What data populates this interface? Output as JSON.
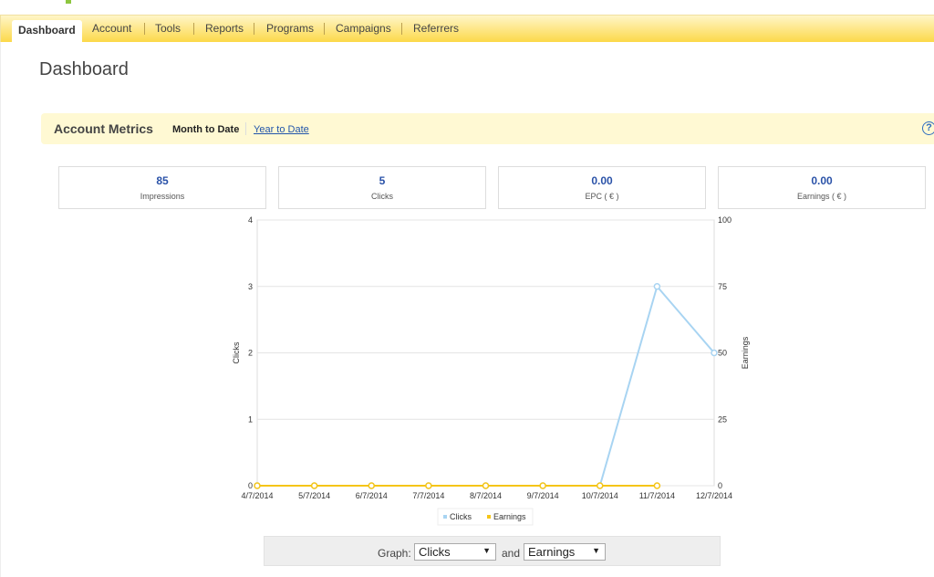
{
  "nav": {
    "tabs": [
      "Dashboard",
      "Account",
      "Tools",
      "Reports",
      "Programs",
      "Campaigns",
      "Referrers"
    ]
  },
  "page_title": "Dashboard",
  "metrics": {
    "title": "Account Metrics",
    "month": "Month to Date",
    "year": "Year to Date",
    "help": "?",
    "cards": [
      {
        "value": "85",
        "label": "Impressions"
      },
      {
        "value": "5",
        "label": "Clicks"
      },
      {
        "value": "0.00",
        "label": "EPC ( € )"
      },
      {
        "value": "0.00",
        "label": "Earnings ( € )"
      }
    ]
  },
  "chart_data": {
    "type": "line",
    "categories": [
      "4/7/2014",
      "5/7/2014",
      "6/7/2014",
      "7/7/2014",
      "8/7/2014",
      "9/7/2014",
      "10/7/2014",
      "11/7/2014",
      "12/7/2014"
    ],
    "series": [
      {
        "name": "Clicks",
        "axis": "left",
        "color": "#a8d4f2",
        "values": [
          0,
          0,
          0,
          0,
          0,
          0,
          0,
          3,
          2
        ]
      },
      {
        "name": "Earnings",
        "axis": "right",
        "color": "#f5c518",
        "values": [
          0,
          0,
          0,
          0,
          0,
          0,
          0,
          0,
          null
        ]
      }
    ],
    "ylabel": "Clicks",
    "y2label": "Earnings",
    "ylim": [
      0,
      4
    ],
    "y2lim": [
      0,
      100
    ],
    "yticks": [
      0,
      1,
      2,
      3,
      4
    ],
    "y2ticks": [
      0,
      25,
      50,
      75,
      100
    ],
    "grid": true,
    "legend": "bottom"
  },
  "graph_controls": {
    "label": "Graph:",
    "first": "Clicks",
    "and": "and",
    "second": "Earnings"
  }
}
